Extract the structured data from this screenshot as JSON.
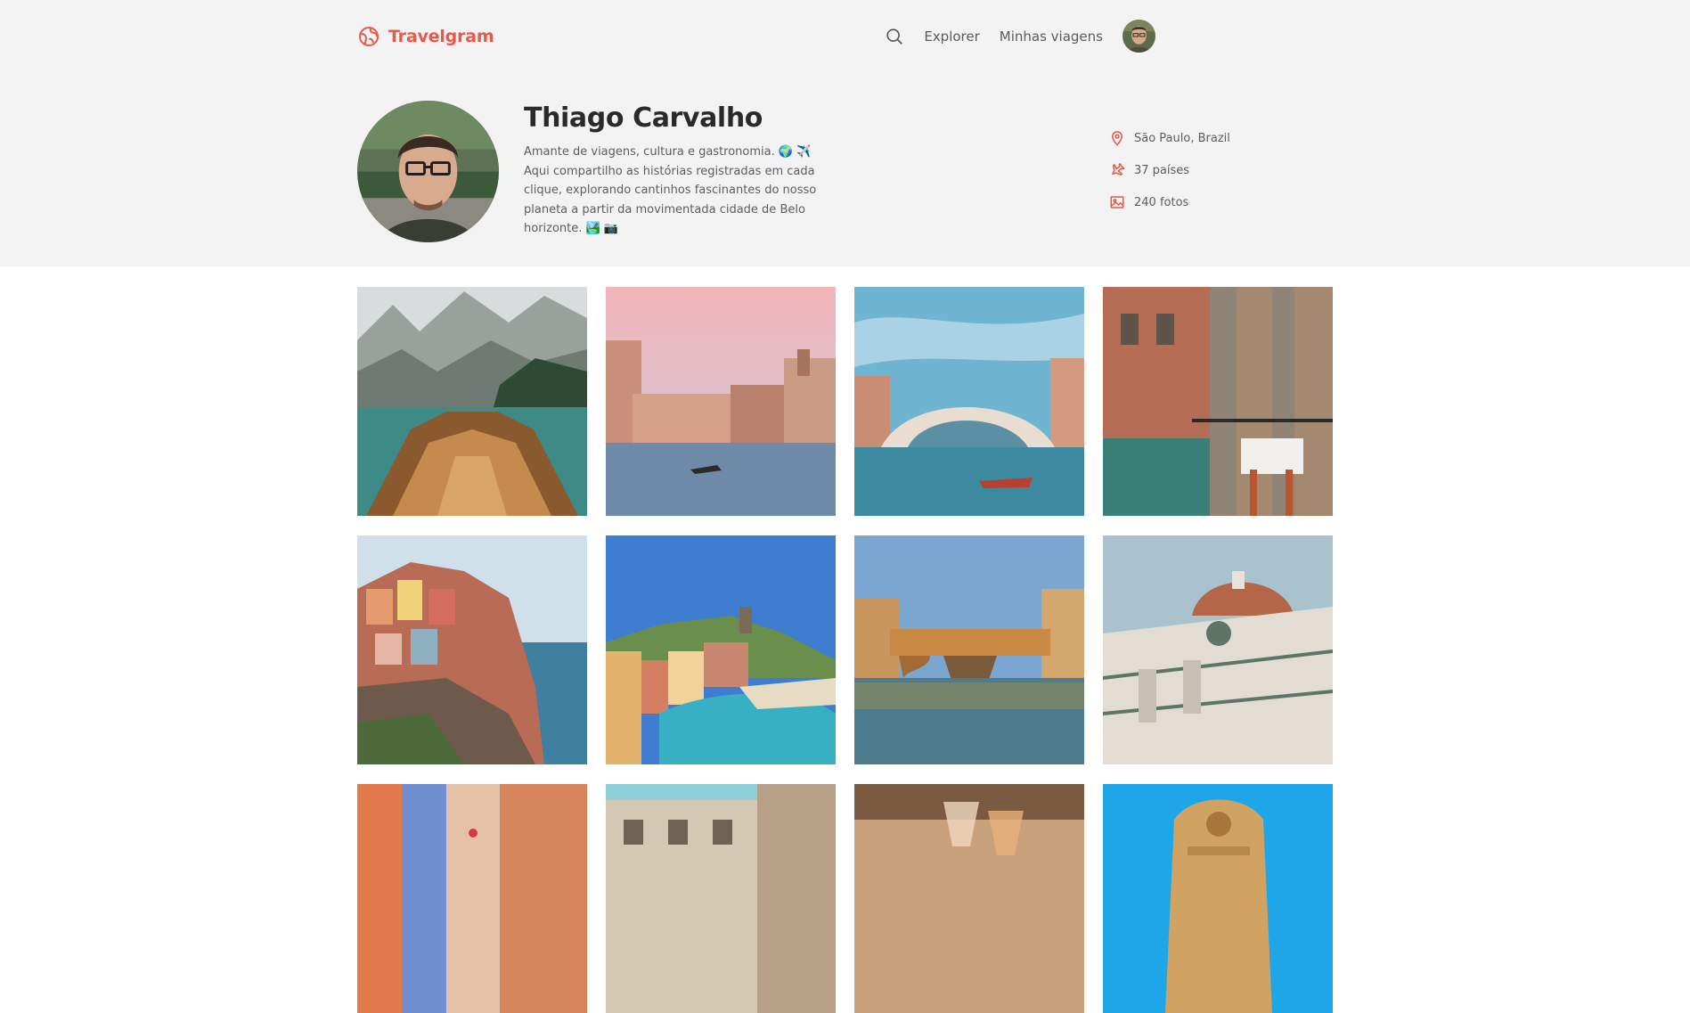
{
  "brand": {
    "name": "Travelgram",
    "color": "#e55a4a"
  },
  "nav": {
    "search_icon": "search-icon",
    "links": [
      "Explorer",
      "Minhas viagens"
    ]
  },
  "profile": {
    "name": "Thiago Carvalho",
    "bio": "Amante de viagens, cultura e gastronomia. 🌍 ✈️ Aqui compartilho as histórias registradas em cada clique, explorando cantinhos fascinantes do nosso planeta a partir da movimentada cidade de Belo horizonte. 🏞️ 📷",
    "stats": {
      "location": "São Paulo, Brazil",
      "countries": "37 países",
      "photos": "240 fotos"
    }
  },
  "gallery": {
    "photos": [
      "mountain-lake-boat",
      "venice-canal-pink-sky",
      "rialto-bridge",
      "venice-restaurant-terrace",
      "manarola-cliff",
      "vernazza-harbor",
      "ponte-vecchio",
      "florence-duomo",
      "colorful-street",
      "old-building-plaza",
      "wine-glasses",
      "baroque-facade"
    ]
  }
}
